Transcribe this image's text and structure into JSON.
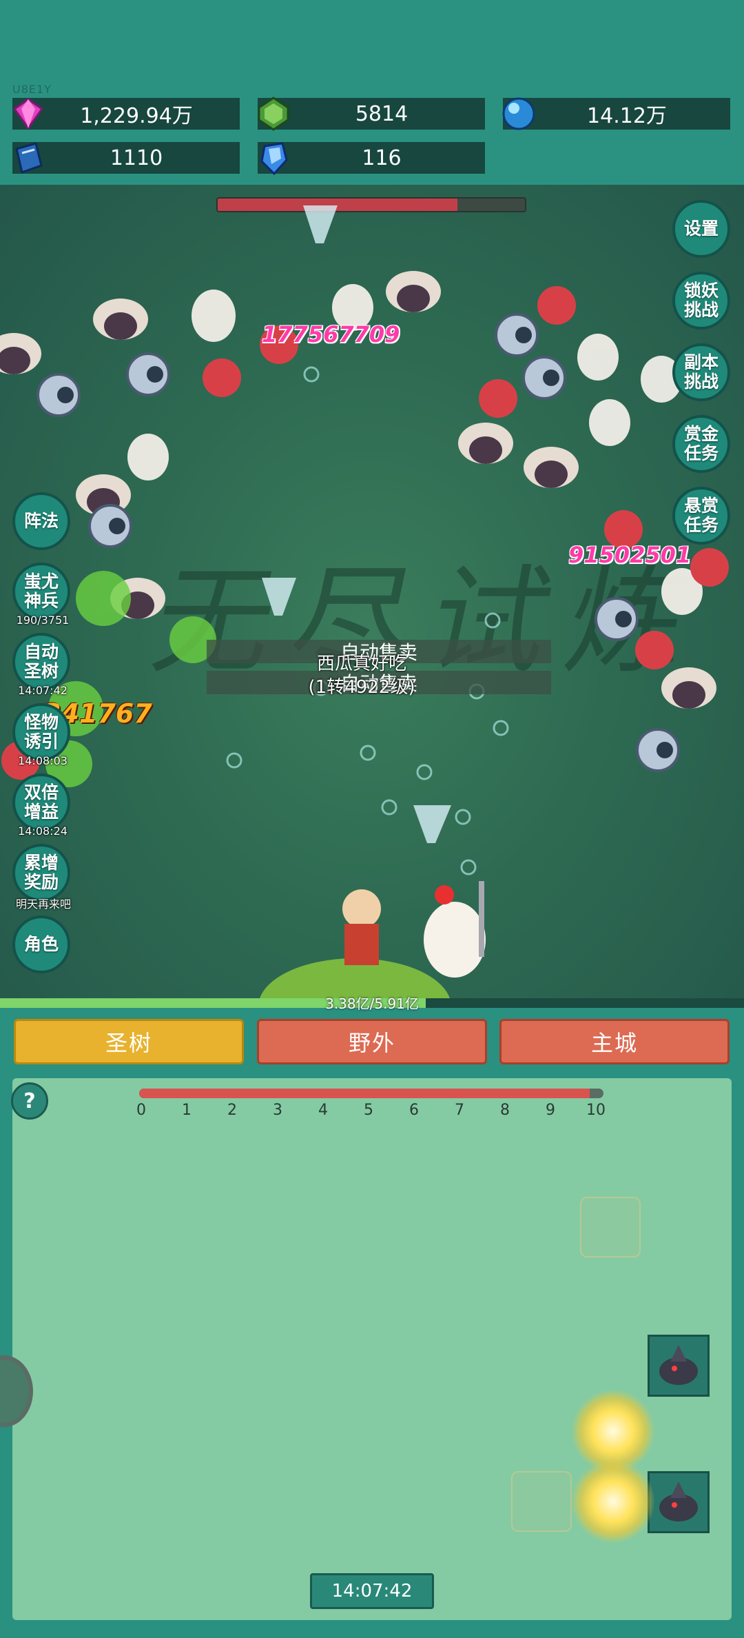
{
  "uid": "U8E1Y",
  "resources": [
    {
      "icon": "pink-diamond-icon",
      "value": "1,229.94万"
    },
    {
      "icon": "green-gem-icon",
      "value": "5814"
    },
    {
      "icon": "blue-orb-icon",
      "value": "14.12万"
    },
    {
      "icon": "blue-book-icon",
      "value": "1110"
    },
    {
      "icon": "blue-crystal-icon",
      "value": "116"
    }
  ],
  "battle": {
    "watermark": "无尽试炼",
    "boss_hp_fraction": 0.78,
    "damage_numbers": [
      "177567709",
      "91502501",
      "341767"
    ],
    "auto_sell": [
      "自动售卖",
      "自动售卖"
    ],
    "player_name": "西瓜真好吃",
    "player_level": "(1转4922级)",
    "exp_text": "3.38亿/5.91亿",
    "exp_fraction": 0.572
  },
  "right_buttons": [
    {
      "label": "设置"
    },
    {
      "label": "锁妖\n挑战"
    },
    {
      "label": "副本\n挑战"
    },
    {
      "label": "赏金\n任务"
    },
    {
      "label": "悬赏\n任务"
    }
  ],
  "left_buttons": [
    {
      "label": "阵法",
      "sub": ""
    },
    {
      "label": "蚩尤\n神兵",
      "sub": "190/3751"
    },
    {
      "label": "自动\n圣树",
      "sub": "14:07:42"
    },
    {
      "label": "怪物\n诱引",
      "sub": "14:08:03"
    },
    {
      "label": "双倍\n增益",
      "sub": "14:08:24"
    },
    {
      "label": "累增\n奖励",
      "sub": "明天再来吧"
    },
    {
      "label": "角色",
      "sub": ""
    }
  ],
  "tabs": {
    "tree": "圣树",
    "field": "野外",
    "city": "主城"
  },
  "tree_panel": {
    "help": "?",
    "ruler_ticks": [
      "0",
      "1",
      "2",
      "3",
      "4",
      "5",
      "6",
      "7",
      "8",
      "9",
      "10"
    ],
    "ruler_fraction": 0.97,
    "timer": "14:07:42"
  },
  "colors": {
    "tab_tree": "#e8b22e",
    "tab_other": "#dd6a52",
    "panel": "#84cba3"
  }
}
